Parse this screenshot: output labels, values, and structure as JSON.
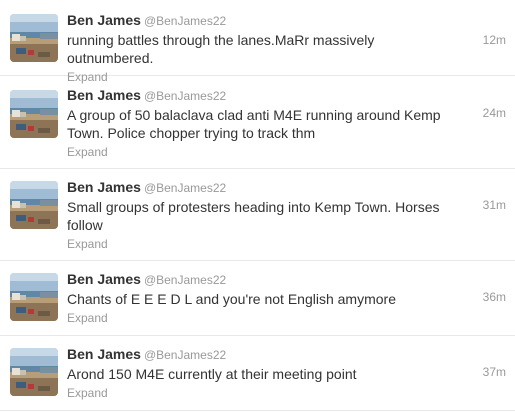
{
  "tweets": [
    {
      "fullname": "Ben James",
      "username": "@BenJames22",
      "text": "running battles through the lanes.MaRr massively outnumbered.",
      "expand_label": "Expand",
      "time": "12m"
    },
    {
      "fullname": "Ben James",
      "username": "@BenJames22",
      "text": "A group of 50 balaclava clad anti M4E running around Kemp Town. Police chopper trying to track  thm",
      "expand_label": "Expand",
      "time": "24m"
    },
    {
      "fullname": "Ben James",
      "username": "@BenJames22",
      "text": "Small groups of protesters heading into Kemp Town. Horses follow",
      "expand_label": "Expand",
      "time": "31m"
    },
    {
      "fullname": "Ben James",
      "username": "@BenJames22",
      "text": "Chants of E E E D L and you're not English amymore",
      "expand_label": "Expand",
      "time": "36m"
    },
    {
      "fullname": "Ben James",
      "username": "@BenJames22",
      "text": "Arond 150 M4E currently at their meeting point",
      "expand_label": "Expand",
      "time": "37m"
    }
  ],
  "colors": {
    "text": "#333333",
    "muted": "#999999",
    "divider": "#e8e8e8"
  },
  "icons": {
    "avatar": "beach-photo-avatar"
  }
}
